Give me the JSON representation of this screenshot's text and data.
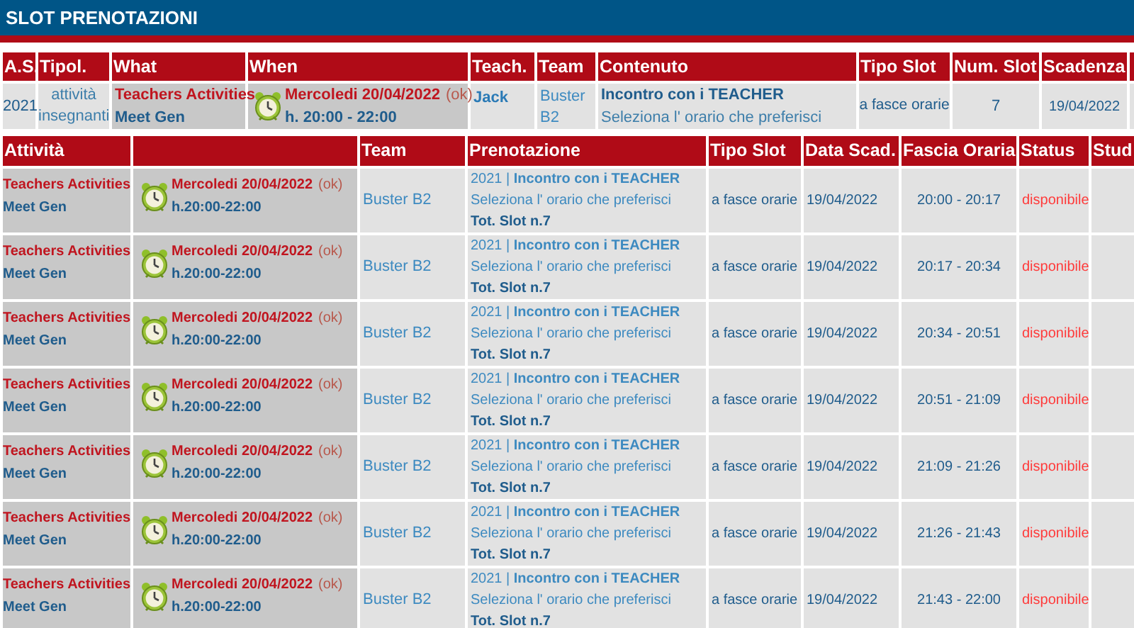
{
  "title": "SLOT PRENOTAZIONI",
  "summary": {
    "columns": [
      "A.S.",
      "Tipol.",
      "What",
      "When",
      "Teach.",
      "Team",
      "Contenuto",
      "Tipo Slot",
      "Num. Slot",
      "Scadenza"
    ],
    "row": {
      "year": "2021",
      "type": "attività insegnanti",
      "activity": "Teachers Activities",
      "name": "Meet Gen",
      "date": "Mercoledi 20/04/2022",
      "check": "(ok)",
      "time": "h. 20:00 - 22:00",
      "teacher": "Jack",
      "team": "Buster B2",
      "content_title": "Incontro con i TEACHER",
      "content_text": "Seleziona l' orario che preferisci",
      "slot_type": "a fasce orarie",
      "slot_count": "7",
      "deadline": "19/04/2022"
    }
  },
  "bookings": {
    "columns": [
      "Attività",
      "",
      "Team",
      "Prenotazione",
      "Tipo Slot",
      "Data Scad.",
      "Fascia Oraria",
      "Status",
      "Stud"
    ],
    "rows": [
      {
        "activity": "Teachers Activities",
        "name": "Meet Gen",
        "date": "Mercoledi 20/04/2022",
        "check": "(ok)",
        "time": "h.20:00-22:00",
        "team": "Buster B2",
        "booking": "2021 | **Incontro con i TEACHER**",
        "booking_text": "Seleziona l' orario che preferisci",
        "total": "Tot. Slot n.7",
        "slot_type": "a fasce orarie",
        "deadline": "19/04/2022",
        "range": "20:00 - 20:17",
        "status": "disponibile"
      },
      {
        "activity": "Teachers Activities",
        "name": "Meet Gen",
        "date": "Mercoledi 20/04/2022",
        "check": "(ok)",
        "time": "h.20:00-22:00",
        "team": "Buster B2",
        "booking": "2021 | **Incontro con i TEACHER**",
        "booking_text": "Seleziona l' orario che preferisci",
        "total": "Tot. Slot n.7",
        "slot_type": "a fasce orarie",
        "deadline": "19/04/2022",
        "range": "20:17 - 20:34",
        "status": "disponibile"
      },
      {
        "activity": "Teachers Activities",
        "name": "Meet Gen",
        "date": "Mercoledi 20/04/2022",
        "check": "(ok)",
        "time": "h.20:00-22:00",
        "team": "Buster B2",
        "booking": "2021 | **Incontro con i TEACHER**",
        "booking_text": "Seleziona l' orario che preferisci",
        "total": "Tot. Slot n.7",
        "slot_type": "a fasce orarie",
        "deadline": "19/04/2022",
        "range": "20:34 - 20:51",
        "status": "disponibile"
      },
      {
        "activity": "Teachers Activities",
        "name": "Meet Gen",
        "date": "Mercoledi 20/04/2022",
        "check": "(ok)",
        "time": "h.20:00-22:00",
        "team": "Buster B2",
        "booking": "2021 | **Incontro con i TEACHER**",
        "booking_text": "Seleziona l' orario che preferisci",
        "total": "Tot. Slot n.7",
        "slot_type": "a fasce orarie",
        "deadline": "19/04/2022",
        "range": "20:51 - 21:09",
        "status": "disponibile"
      },
      {
        "activity": "Teachers Activities",
        "name": "Meet Gen",
        "date": "Mercoledi 20/04/2022",
        "check": "(ok)",
        "time": "h.20:00-22:00",
        "team": "Buster B2",
        "booking": "2021 | **Incontro con i TEACHER**",
        "booking_text": "Seleziona l' orario che preferisci",
        "total": "Tot. Slot n.7",
        "slot_type": "a fasce orarie",
        "deadline": "19/04/2022",
        "range": "21:09 - 21:26",
        "status": "disponibile"
      },
      {
        "activity": "Teachers Activities",
        "name": "Meet Gen",
        "date": "Mercoledi 20/04/2022",
        "check": "(ok)",
        "time": "h.20:00-22:00",
        "team": "Buster B2",
        "booking": "2021 | **Incontro con i TEACHER**",
        "booking_text": "Seleziona l' orario che preferisci",
        "total": "Tot. Slot n.7",
        "slot_type": "a fasce orarie",
        "deadline": "19/04/2022",
        "range": "21:26 - 21:43",
        "status": "disponibile"
      },
      {
        "activity": "Teachers Activities",
        "name": "Meet Gen",
        "date": "Mercoledi 20/04/2022",
        "check": "(ok)",
        "time": "h.20:00-22:00",
        "team": "Buster B2",
        "booking": "2021 | **Incontro con i TEACHER**",
        "booking_text": "Seleziona l' orario che preferisci",
        "total": "Tot. Slot n.7",
        "slot_type": "a fasce orarie",
        "deadline": "19/04/2022",
        "range": "21:43 - 22:00",
        "status": "disponibile"
      }
    ]
  }
}
